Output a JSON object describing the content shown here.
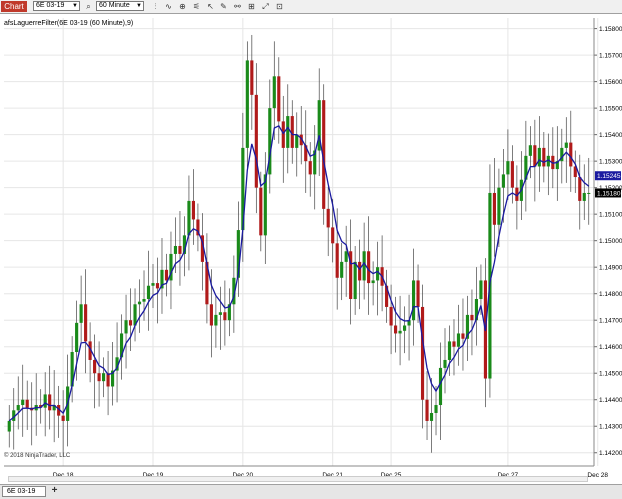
{
  "toolbar": {
    "chart_label": "Chart",
    "instrument": "6E 03-19",
    "interval": "60 Minute"
  },
  "indicator_label": "afsLaguerreFilter(6E 03-19 (60 Minute),9)",
  "copyright": "© 2018 NinjaTrader, LLC",
  "tab": {
    "label": "6E 03-19",
    "add_label": "+"
  },
  "colors": {
    "up": "#1a8a1a",
    "down": "#b01a1a",
    "filter": "#1a1aa0",
    "grid": "#e6e6e6"
  },
  "chart_data": {
    "type": "candlestick",
    "y_ticks": [
      1.142,
      1.143,
      1.144,
      1.145,
      1.146,
      1.147,
      1.148,
      1.149,
      1.15,
      1.151,
      1.152,
      1.153,
      1.154,
      1.155,
      1.156,
      1.157,
      1.158
    ],
    "y_tick_labels": [
      "1.14200",
      "1.14300",
      "1.14400",
      "1.14500",
      "1.14600",
      "1.14700",
      "1.14800",
      "1.14900",
      "1.15000",
      "1.15100",
      "1.15200",
      "1.15300",
      "1.15400",
      "1.15500",
      "1.15600",
      "1.15700",
      "1.15800"
    ],
    "ylim": [
      1.1415,
      1.1584
    ],
    "x_labels": [
      {
        "label": "Dec 18",
        "index": 12
      },
      {
        "label": "Dec 19",
        "index": 32
      },
      {
        "label": "Dec 20",
        "index": 52
      },
      {
        "label": "Dec 21",
        "index": 72
      },
      {
        "label": "Dec 25",
        "index": 85
      },
      {
        "label": "Dec 27",
        "index": 111
      },
      {
        "label": "Dec 28",
        "index": 131
      }
    ],
    "price_markers": [
      {
        "label": "1.15245",
        "value": 1.15245,
        "color": "#1a1aa0"
      },
      {
        "label": "1.15180",
        "value": 1.1518,
        "color": "#000000"
      }
    ],
    "candles_close": [
      1.1432,
      1.1436,
      1.1438,
      1.144,
      1.1437,
      1.1436,
      1.1438,
      1.1437,
      1.1442,
      1.1436,
      1.1438,
      1.1434,
      1.1432,
      1.1445,
      1.1458,
      1.1469,
      1.1476,
      1.1462,
      1.1455,
      1.145,
      1.1447,
      1.145,
      1.1445,
      1.1451,
      1.1456,
      1.1465,
      1.147,
      1.1468,
      1.1476,
      1.1477,
      1.1478,
      1.1483,
      1.1484,
      1.1482,
      1.1489,
      1.1485,
      1.1495,
      1.1498,
      1.1495,
      1.1502,
      1.1515,
      1.1508,
      1.1502,
      1.1492,
      1.1476,
      1.1468,
      1.1472,
      1.1473,
      1.147,
      1.1476,
      1.1486,
      1.1504,
      1.1535,
      1.1568,
      1.1555,
      1.152,
      1.1502,
      1.1525,
      1.155,
      1.1562,
      1.1545,
      1.1535,
      1.1547,
      1.1535,
      1.154,
      1.1536,
      1.153,
      1.1525,
      1.1534,
      1.1553,
      1.1512,
      1.1505,
      1.1499,
      1.1486,
      1.1492,
      1.1496,
      1.1478,
      1.1492,
      1.1485,
      1.1496,
      1.1484,
      1.1485,
      1.149,
      1.1483,
      1.1475,
      1.1468,
      1.1465,
      1.1466,
      1.1468,
      1.147,
      1.1485,
      1.1475,
      1.144,
      1.1432,
      1.1435,
      1.1438,
      1.1452,
      1.1455,
      1.1462,
      1.146,
      1.1465,
      1.1463,
      1.1472,
      1.147,
      1.1478,
      1.1485,
      1.1448,
      1.1518,
      1.1506,
      1.152,
      1.1525,
      1.153,
      1.152,
      1.1515,
      1.1523,
      1.1532,
      1.1536,
      1.1528,
      1.1535,
      1.1528,
      1.1532,
      1.1527,
      1.153,
      1.1535,
      1.1537,
      1.1528,
      1.1524,
      1.1515,
      1.1518,
      1.1518
    ]
  }
}
